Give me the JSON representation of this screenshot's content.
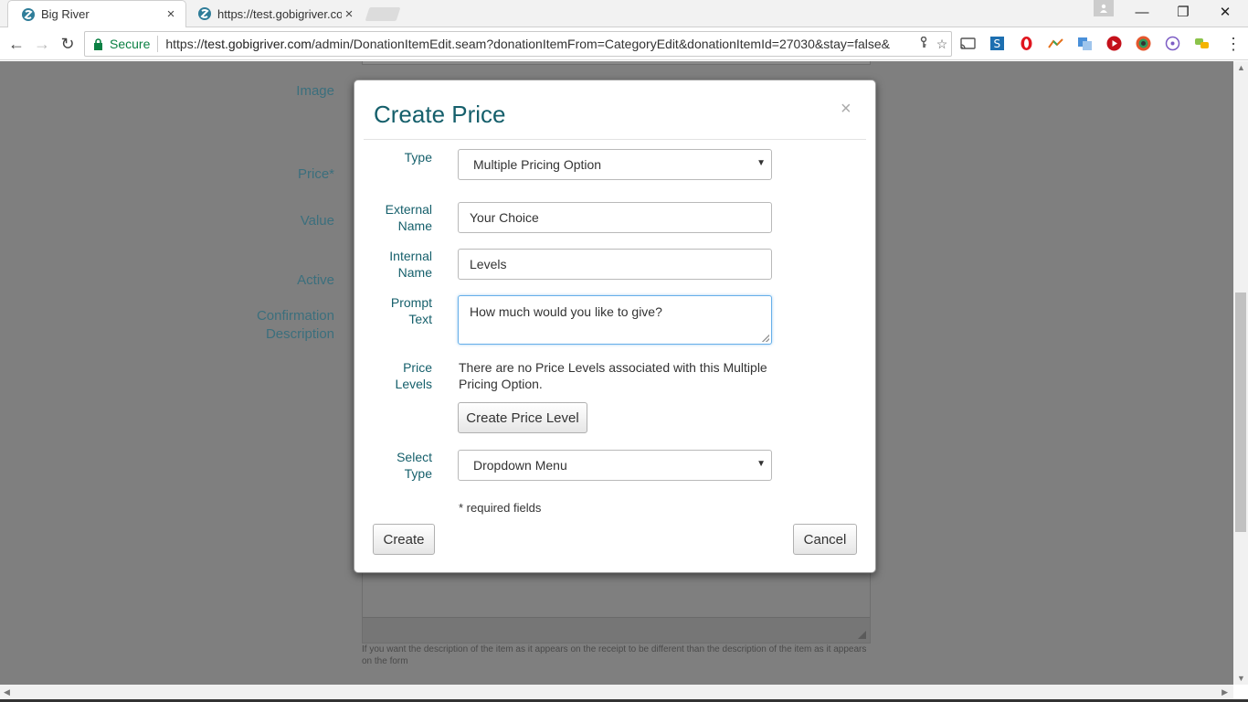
{
  "browser": {
    "tabs": [
      {
        "title": "Big River",
        "active": true
      },
      {
        "title": "https://test.gobigriver.co",
        "active": false
      }
    ],
    "tab_close_glyph": "×",
    "window_controls": {
      "minimize": "—",
      "restore": "❐",
      "close": "✕"
    },
    "secure_label": "Secure",
    "url_scheme": "https://",
    "url_host": "test.gobigriver.com",
    "url_path": "/admin/DonationItemEdit.seam?donationItemFrom=CategoryEdit&donationItemId=27030&stay=false&",
    "extension_icons": [
      "cast-icon",
      "s-extension-icon",
      "opera-icon",
      "analytics-icon",
      "translate-icon",
      "youtube-icon",
      "color-picker-icon",
      "target-icon",
      "chat-icon"
    ],
    "menu_glyph": "⋮"
  },
  "background_form": {
    "labels": {
      "image": "Image",
      "price": "Price*",
      "value": "Value",
      "active": "Active",
      "confirmation_line1": "Confirmation",
      "confirmation_line2": "Description"
    },
    "help_text": "If you want the description of the item as it appears on the receipt to be different than the description of the item as it appears on the form"
  },
  "modal": {
    "title": "Create Price",
    "close_glyph": "×",
    "type_label": "Type",
    "type_value": "Multiple Pricing Option",
    "external_name_label_1": "External",
    "external_name_label_2": "Name",
    "external_name_value": "Your Choice",
    "internal_name_label_1": "Internal",
    "internal_name_label_2": "Name",
    "internal_name_value": "Levels",
    "prompt_text_label_1": "Prompt",
    "prompt_text_label_2": "Text",
    "prompt_text_value": "How much would you like to give?",
    "price_levels_label_1": "Price",
    "price_levels_label_2": "Levels",
    "no_price_levels_text": "There are no Price Levels associated with this Multiple Pricing Option.",
    "create_price_level_button": "Create Price Level",
    "select_type_label_1": "Select",
    "select_type_label_2": "Type",
    "select_type_value": "Dropdown Menu",
    "required_note": "* required fields",
    "create_button": "Create",
    "cancel_button": "Cancel"
  },
  "colors": {
    "accent": "#155f6b",
    "secure_green": "#0b8043",
    "overlay": "#7f7f7f"
  }
}
